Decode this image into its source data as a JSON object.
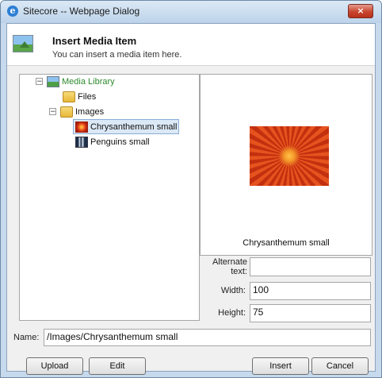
{
  "window": {
    "title": "Sitecore -- Webpage Dialog",
    "close_glyph": "×"
  },
  "header": {
    "title": "Insert Media Item",
    "subtitle": "You can insert a media item here."
  },
  "tree": {
    "root": {
      "label": "Media Library",
      "expander": "−"
    },
    "files": {
      "label": "Files"
    },
    "images": {
      "label": "Images",
      "expander": "−"
    },
    "chrysanthemum": {
      "label": "Chrysanthemum small"
    },
    "penguins": {
      "label": "Penguins small"
    }
  },
  "preview": {
    "caption": "Chrysanthemum small"
  },
  "fields": {
    "alt_label": "Alternate text:",
    "alt_value": "",
    "width_label": "Width:",
    "width_value": "100",
    "height_label": "Height:",
    "height_value": "75"
  },
  "name": {
    "label": "Name:",
    "value": "/Images/Chrysanthemum small"
  },
  "buttons": {
    "upload": "Upload",
    "edit": "Edit",
    "insert": "Insert",
    "cancel": "Cancel"
  },
  "colors": {
    "tree_root_text": "#2d8a2d",
    "close_button": "#c8452f"
  }
}
